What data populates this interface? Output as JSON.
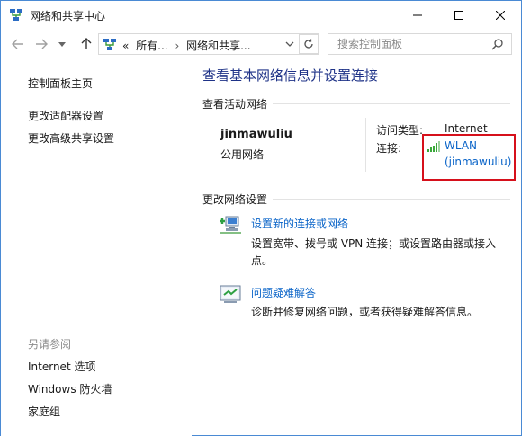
{
  "window": {
    "title": "网络和共享中心",
    "controls": {
      "minimize": "minimize-icon",
      "maximize": "maximize-icon",
      "close": "close-icon"
    }
  },
  "addressbar": {
    "crumbs_prefix": "«",
    "crumb_1": "所有...",
    "separator": "›",
    "crumb_2": "网络和共享...",
    "search_placeholder": "搜索控制面板"
  },
  "sidebar": {
    "top_links": [
      {
        "label": "控制面板主页"
      },
      {
        "label": "更改适配器设置"
      },
      {
        "label": "更改高级共享设置"
      }
    ],
    "see_also_heading": "另请参阅",
    "see_also_links": [
      {
        "label": "Internet 选项"
      },
      {
        "label": "Windows 防火墙"
      },
      {
        "label": "家庭组"
      }
    ]
  },
  "main": {
    "heading": "查看基本网络信息并设置连接",
    "active_networks": {
      "section_label": "查看活动网络",
      "network_name": "jinmawuliu",
      "network_type": "公用网络",
      "access_type_label": "访问类型:",
      "access_type_value": "Internet",
      "connection_label": "连接:",
      "connection_line1": "WLAN",
      "connection_line2": "(jinmawuliu)"
    },
    "change_settings": {
      "section_label": "更改网络设置",
      "tasks": [
        {
          "link": "设置新的连接或网络",
          "desc": "设置宽带、拨号或 VPN 连接；或设置路由器或接入点。",
          "icon": "new-connection-icon"
        },
        {
          "link": "问题疑难解答",
          "desc": "诊断并修复网络问题，或者获得疑难解答信息。",
          "icon": "troubleshoot-icon"
        }
      ]
    }
  },
  "colors": {
    "heading": "#1e3287",
    "link": "#0a64c8",
    "highlight_box": "#d6101b",
    "window_border": "#4a8ad4"
  }
}
